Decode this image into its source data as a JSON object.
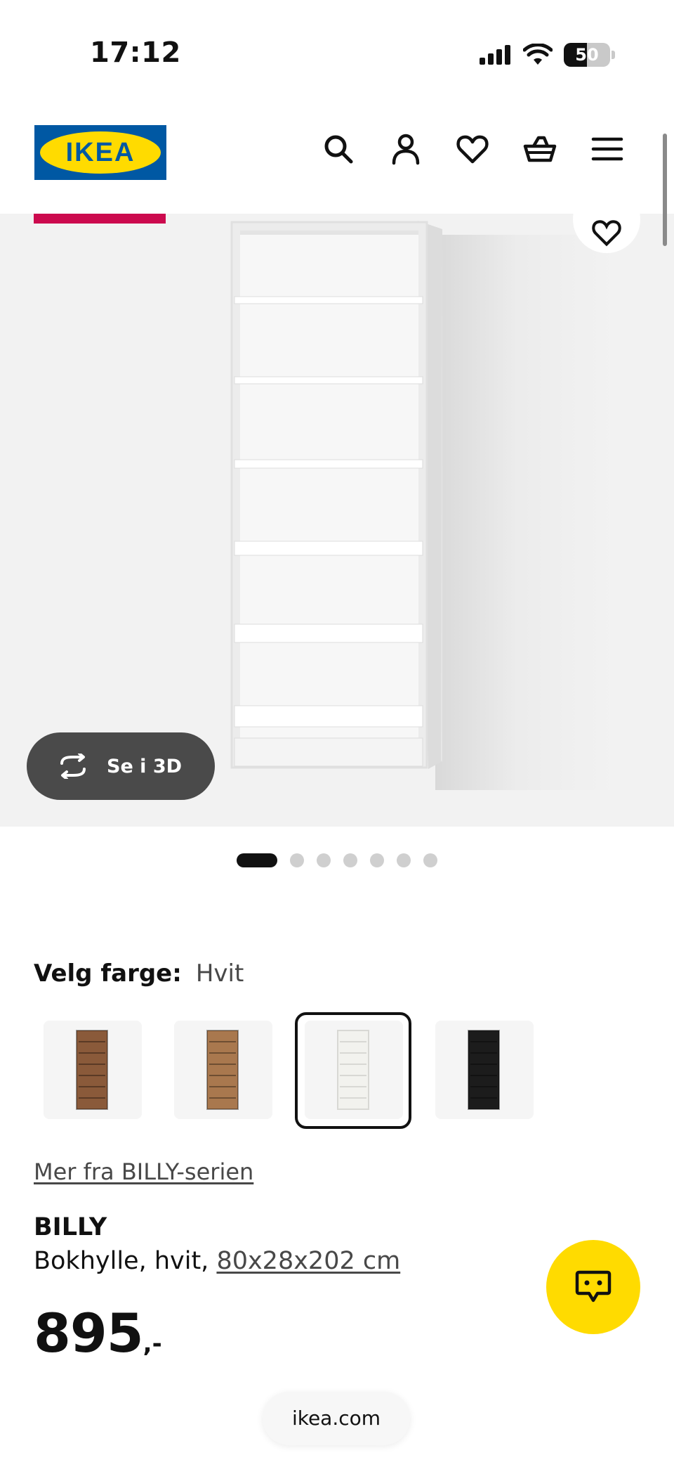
{
  "status_bar": {
    "time": "17:12",
    "battery": "50",
    "battery_level_percent": 50
  },
  "header": {
    "logo_text": "IKEA",
    "icons": [
      "search-icon",
      "account-icon",
      "favorites-icon",
      "cart-icon",
      "menu-icon"
    ]
  },
  "gallery": {
    "view_3d_label": "Se i 3D",
    "slide_count": 7,
    "active_slide": 1
  },
  "color_picker": {
    "label": "Velg farge:",
    "selected": "Hvit",
    "swatches": [
      {
        "color": "#8a5a3a",
        "selected": false
      },
      {
        "color": "#a9784e",
        "selected": false
      },
      {
        "color": "#f2f2ee",
        "selected": true
      },
      {
        "color": "#1c1c1c",
        "selected": false
      }
    ]
  },
  "product": {
    "series_link": "Mer fra BILLY-serien",
    "name": "BILLY",
    "description": "Bokhylle, hvit,",
    "dimensions": "80x28x202 cm",
    "price": "895",
    "price_suffix": ",-"
  },
  "browser": {
    "url": "ikea.com"
  },
  "colors": {
    "brand_blue": "#0058a3",
    "brand_yellow": "#ffdb00",
    "promo_red": "#cc0a4e"
  }
}
